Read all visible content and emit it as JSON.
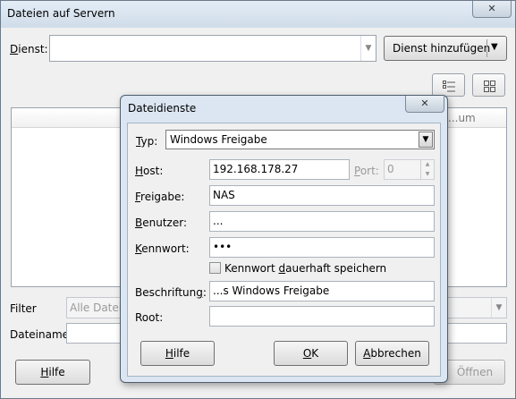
{
  "window": {
    "title": "Dateien auf Servern",
    "close_glyph": "✕",
    "service_label": "Dienst:",
    "service_value": "",
    "add_service_button": "Dienst hinzufügen",
    "view_list_icon": "list-view-icon",
    "view_grid_icon": "grid-view-icon",
    "column_headers_visible": [
      "...um"
    ],
    "filter_label": "Filter",
    "filter_value": "Alle Dateien",
    "filename_label": "Dateiname",
    "filename_value": "",
    "help_button": "Hilfe",
    "open_button": "Öffnen"
  },
  "dialog": {
    "title": "Dateidienste",
    "close_glyph": "✕",
    "type_label": "Typ:",
    "type_value": "Windows Freigabe",
    "host_label": "Host:",
    "host_value": "192.168.178.27",
    "port_label": "Port:",
    "port_value": "0",
    "share_label": "Freigabe:",
    "share_value": "NAS",
    "user_label": "Benutzer:",
    "user_value": "...",
    "password_label": "Kennwort:",
    "password_value": "•••",
    "save_password_label": "Kennwort dauerhaft speichern",
    "save_password_checked": false,
    "caption_label": "Beschriftung:",
    "caption_value": "...s Windows Freigabe",
    "root_label": "Root:",
    "root_value": "",
    "help_button": "Hilfe",
    "ok_button": "OK",
    "cancel_button": "Abbrechen"
  }
}
